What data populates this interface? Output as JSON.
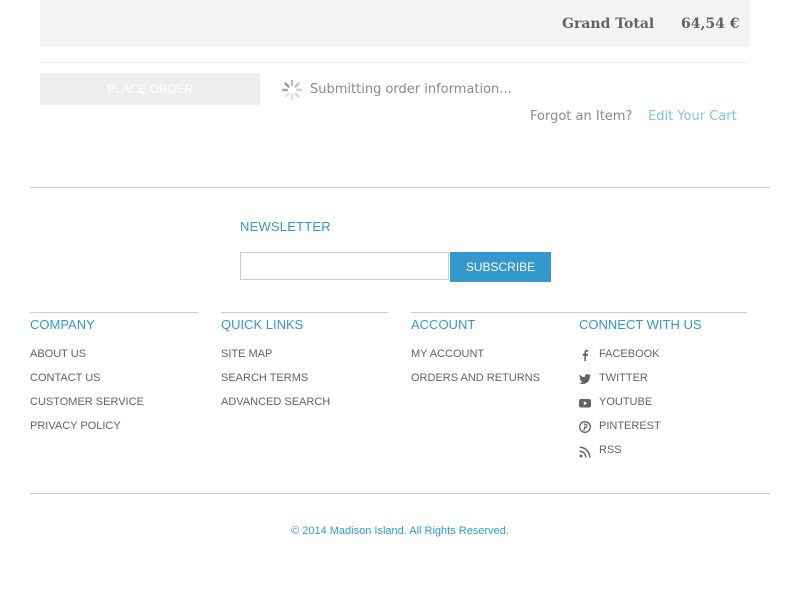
{
  "review": {
    "grand_total_label": "Grand Total",
    "grand_total_value": "64,54 €",
    "place_order_label": "PLACE ORDER",
    "submitting_text": "Submitting order information...",
    "forgot_text": "Forgot an Item?",
    "edit_cart_label": "Edit Your Cart"
  },
  "newsletter": {
    "title": "NEWSLETTER",
    "input_value": "",
    "subscribe_label": "SUBSCRIBE"
  },
  "footer": {
    "company": {
      "title": "COMPANY",
      "links": [
        "ABOUT US",
        "CONTACT US",
        "CUSTOMER SERVICE",
        "PRIVACY POLICY"
      ]
    },
    "quick_links": {
      "title": "QUICK LINKS",
      "links": [
        "SITE MAP",
        "SEARCH TERMS",
        "ADVANCED SEARCH"
      ]
    },
    "account": {
      "title": "ACCOUNT",
      "links": [
        "MY ACCOUNT",
        "ORDERS AND RETURNS"
      ]
    },
    "connect": {
      "title": "CONNECT WITH US",
      "links": [
        {
          "label": "FACEBOOK",
          "icon": "facebook-icon"
        },
        {
          "label": "TWITTER",
          "icon": "twitter-icon"
        },
        {
          "label": "YOUTUBE",
          "icon": "youtube-icon"
        },
        {
          "label": "PINTEREST",
          "icon": "pinterest-icon"
        },
        {
          "label": "RSS",
          "icon": "rss-icon"
        }
      ]
    },
    "copyright": "© 2014 Madison Island. All Rights Reserved."
  },
  "colors": {
    "accent": "#3399cc",
    "link_light": "#7fc3e5",
    "text": "#636363",
    "muted": "#8a8a8a",
    "total_bg": "#f4f4f4"
  }
}
